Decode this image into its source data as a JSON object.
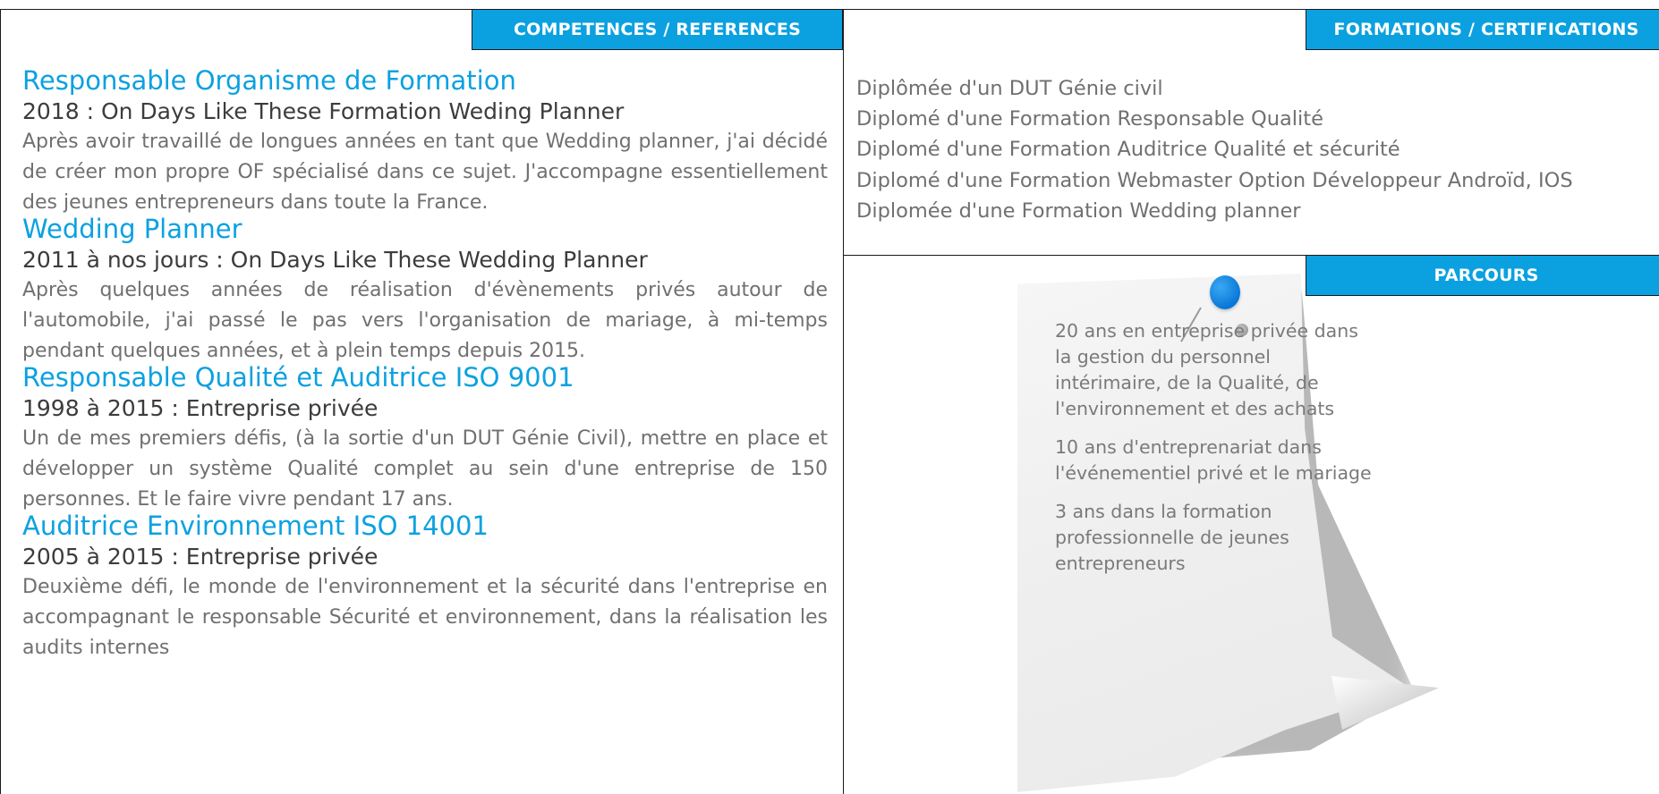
{
  "competences": {
    "heading": "COMPETENCES / REFERENCES",
    "experiences": [
      {
        "title": "Responsable Organisme de Formation",
        "subtitle": "2018 : On Days Like These Formation Weding Planner",
        "description": "Après avoir travaillé de longues années en tant que Wedding planner, j'ai décidé de créer mon propre OF spécialisé dans ce sujet. J'accompagne essentiellement des jeunes entrepreneurs dans toute la France."
      },
      {
        "title": "Wedding Planner",
        "subtitle": "2011 à nos jours : On Days Like These Wedding Planner",
        "description": "Après quelques années de réalisation d'évènements privés autour de l'automobile, j'ai passé le pas vers l'organisation de mariage, à mi-temps pendant quelques années, et à plein temps depuis 2015."
      },
      {
        "title": "Responsable Qualité et Auditrice ISO 9001",
        "subtitle": "1998 à 2015 : Entreprise privée",
        "description": "Un de mes premiers défis, (à la sortie d'un DUT Génie Civil), mettre en place et développer un système Qualité complet au sein d'une entreprise de 150 personnes. Et le faire vivre pendant 17 ans."
      },
      {
        "title": "Auditrice Environnement ISO 14001",
        "subtitle": "2005 à 2015 : Entreprise privée",
        "description": "Deuxième défi, le monde de l'environnement et la sécurité dans l'entreprise en accompagnant le responsable Sécurité et environnement, dans la réalisation les audits internes"
      }
    ]
  },
  "formations": {
    "heading": "FORMATIONS / CERTIFICATIONS",
    "items": [
      "Diplômée d'un DUT Génie civil",
      "Diplomé d'une Formation Responsable Qualité",
      "Diplomé d'une Formation Auditrice Qualité et sécurité",
      "Diplomé d'une Formation Webmaster Option Développeur Androïd, IOS",
      "Diplomée d'une Formation Wedding planner"
    ]
  },
  "parcours": {
    "heading": "PARCOURS",
    "paragraphs": [
      "20 ans en entreprise privée dans la gestion du personnel intérimaire, de la Qualité, de l'environnement et des achats",
      "10 ans d'entreprenariat dans l'événementiel privé et le mariage",
      "3 ans dans la formation professionnelle de jeunes entrepreneurs"
    ]
  },
  "colors": {
    "accent": "#0ba1e0",
    "border": "#1a1a1a",
    "body_text": "#707070",
    "subtitle_text": "#3c3c3c",
    "pin": "#0877d8"
  },
  "icons": {
    "note": "pinned-note-icon",
    "pin": "push-pin-icon"
  }
}
